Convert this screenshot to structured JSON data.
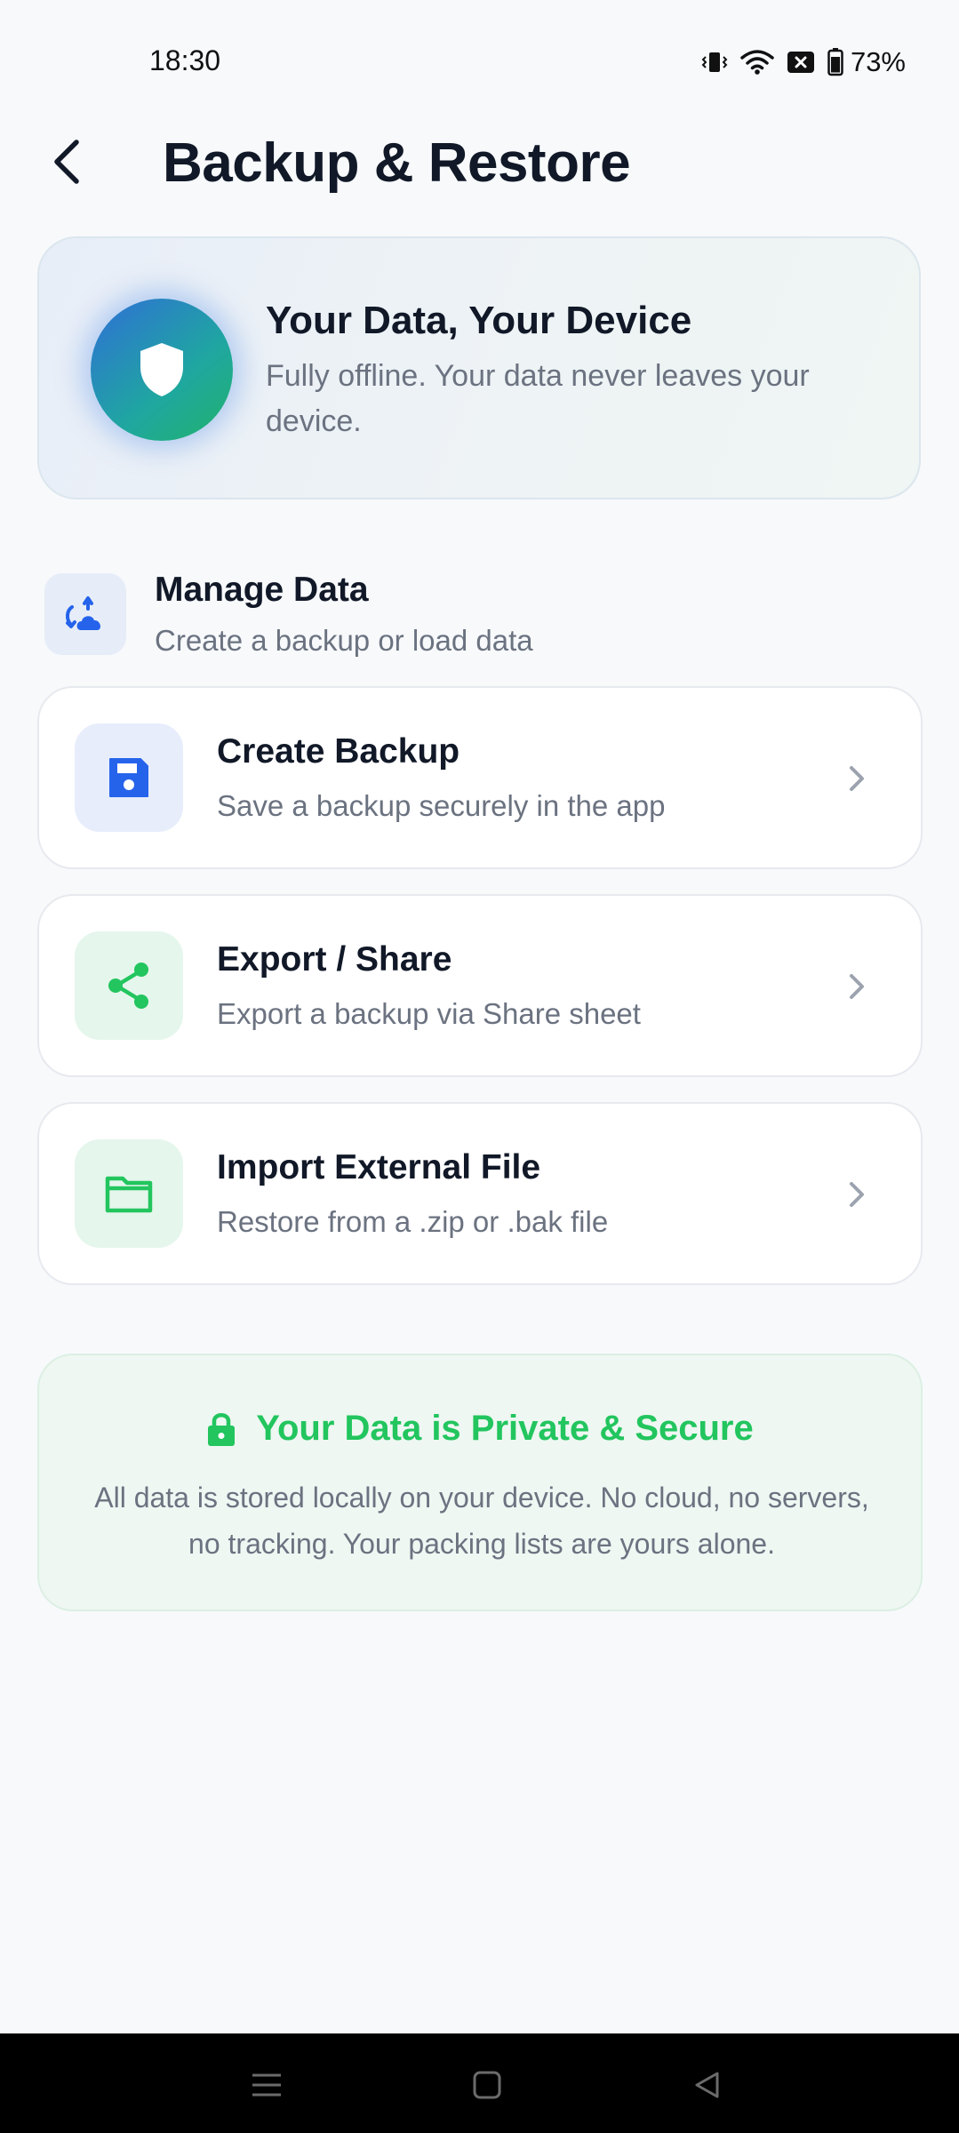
{
  "status_bar": {
    "time": "18:30",
    "battery": "73%",
    "icons": [
      "vibrate-icon",
      "wifi-icon",
      "sim-off-icon",
      "battery-icon"
    ]
  },
  "header": {
    "title": "Backup & Restore",
    "back_icon": "chevron-left-icon"
  },
  "hero": {
    "title": "Your Data, Your Device",
    "subtitle": "Fully offline. Your data never leaves your device.",
    "icon": "shield-icon"
  },
  "section": {
    "title": "Manage Data",
    "subtitle": "Create a backup or load data",
    "icon": "cloud-sync-icon"
  },
  "actions": [
    {
      "title": "Create Backup",
      "subtitle": "Save a backup securely in the app",
      "icon": "save-icon",
      "accent": "#2563eb"
    },
    {
      "title": "Export / Share",
      "subtitle": "Export a backup via Share sheet",
      "icon": "share-icon",
      "accent": "#22c55e"
    },
    {
      "title": "Import External File",
      "subtitle": "Restore from a .zip or .bak file",
      "icon": "folder-icon",
      "accent": "#22c55e"
    }
  ],
  "privacy": {
    "title": "Your Data is Private & Secure",
    "text": "All data is stored locally on your device. No cloud, no servers, no tracking. Your packing lists are yours alone.",
    "icon": "lock-icon",
    "accent": "#22c55e"
  },
  "nav_bar": {
    "buttons": [
      "menu-icon",
      "home-icon",
      "back-triangle-icon"
    ]
  }
}
